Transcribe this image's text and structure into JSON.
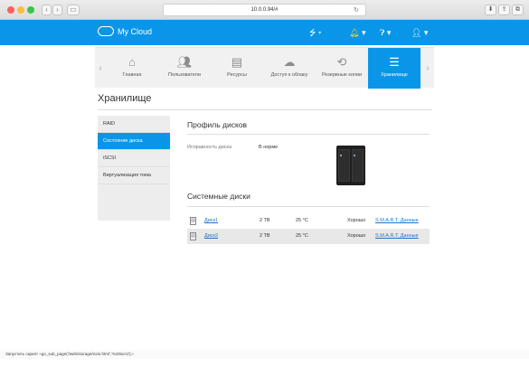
{
  "browser": {
    "url": "10.0.0.94/#",
    "icons": [
      "back-icon",
      "forward-icon",
      "sidebar-icon",
      "reload-icon",
      "download-icon",
      "share-icon",
      "tabs-icon"
    ]
  },
  "header": {
    "logo_text": "My Cloud",
    "icons": [
      "usb-icon",
      "bell-icon",
      "help-icon",
      "user-icon"
    ]
  },
  "nav": {
    "items": [
      {
        "label": "Главная",
        "icon": "home-icon"
      },
      {
        "label": "Пользователи",
        "icon": "users-icon"
      },
      {
        "label": "Ресурсы",
        "icon": "folder-icon"
      },
      {
        "label": "Доступ к облаку",
        "icon": "cloud-access-icon"
      },
      {
        "label": "Резервные копии",
        "icon": "backup-icon"
      },
      {
        "label": "Хранилище",
        "icon": "storage-icon"
      }
    ],
    "active_index": 5
  },
  "page": {
    "title": "Хранилище"
  },
  "sidebar": {
    "items": [
      {
        "label": "RAID"
      },
      {
        "label": "Состояние диска"
      },
      {
        "label": "iSCSI"
      },
      {
        "label": "Виртуализация тома"
      }
    ],
    "active_index": 1
  },
  "profile": {
    "title": "Профиль дисков",
    "health_label": "Исправность диска",
    "health_value": "В норме"
  },
  "system_disks": {
    "title": "Системные диски",
    "rows": [
      {
        "name": "Диск1",
        "size": "2 TB",
        "temp": "25 °C",
        "status": "Хорошо",
        "smart": "S.M.A.R.T. Данные"
      },
      {
        "name": "Диск2",
        "size": "2 TB",
        "temp": "25 °C",
        "status": "Хорошо",
        "smart": "S.M.A.R.T. Данные"
      }
    ]
  },
  "statusbar": {
    "text": "Запустить скрипт «go_sub_page('/web/storage/iscsi.html','%20iscsi');»"
  },
  "colors": {
    "accent": "#0a96e8",
    "link": "#1a73c9"
  }
}
